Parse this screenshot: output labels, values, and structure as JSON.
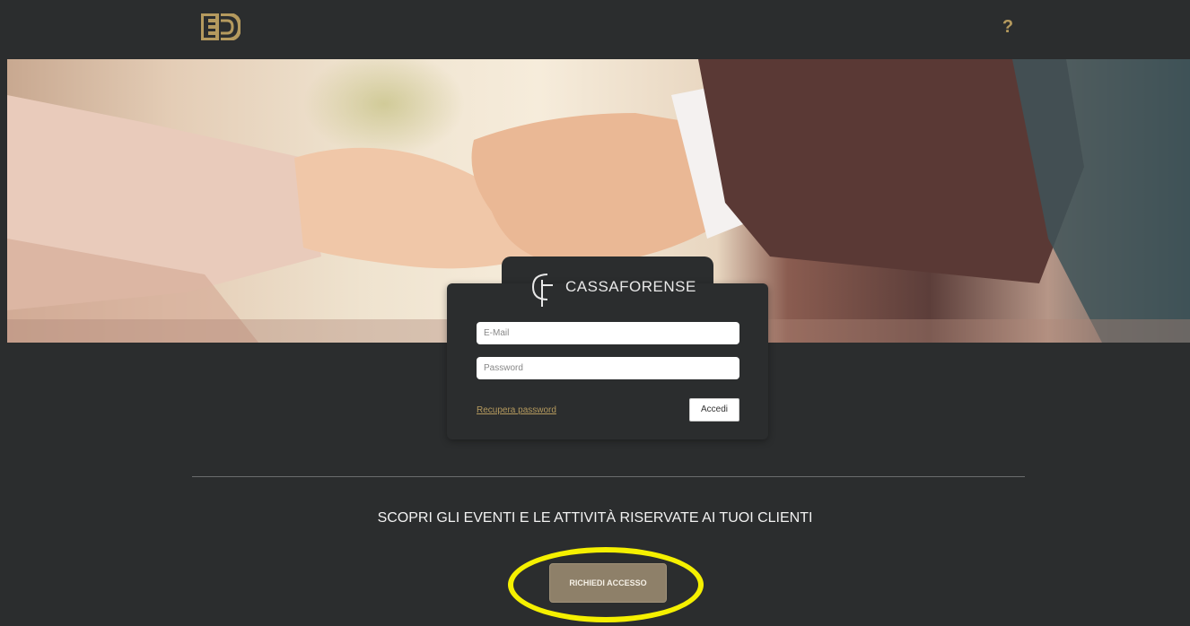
{
  "header": {
    "logo_icon": "ed-monogram-logo",
    "help_label": "?"
  },
  "hero": {
    "image": "handshake-photo"
  },
  "login": {
    "brand_text": "CASSAFORENSE",
    "brand_icon": "cf-monogram-logo",
    "email_placeholder": "E-Mail",
    "password_placeholder": "Password",
    "recover_label": "Recupera password",
    "submit_label": "Accedi"
  },
  "promo": {
    "headline": "SCOPRI GLI EVENTI E LE ATTIVITÀ RISERVATE AI TUOI CLIENTI",
    "request_label": "RICHIEDI ACCESSO"
  },
  "colors": {
    "background": "#2b2d2e",
    "accent_gold": "#b59a5e",
    "button_taupe": "#8e8069",
    "highlight_yellow": "#f5f000"
  }
}
